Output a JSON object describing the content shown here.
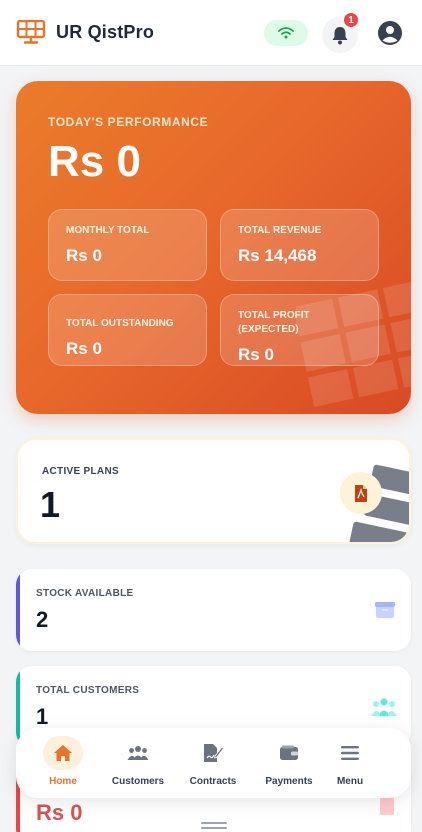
{
  "header": {
    "app_title": "UR QistPro",
    "logo_icon": "solar-panel-icon",
    "wifi_icon": "wifi-icon",
    "bell_icon": "bell-icon",
    "notification_count": "1",
    "profile_icon": "user-circle-icon"
  },
  "performance": {
    "label": "TODAY'S PERFORMANCE",
    "value": "Rs 0",
    "tiles": [
      {
        "label": "MONTHLY TOTAL",
        "value": "Rs 0"
      },
      {
        "label": "TOTAL REVENUE",
        "value": "Rs 14,468"
      },
      {
        "label": "TOTAL OUTSTANDING",
        "value": "Rs 0"
      },
      {
        "label": "TOTAL PROFIT (EXPECTED)",
        "value": "Rs 0"
      }
    ]
  },
  "active_plans": {
    "label": "ACTIVE PLANS",
    "value": "1",
    "icon": "pdf-document-icon"
  },
  "stats": [
    {
      "label": "STOCK AVAILABLE",
      "value": "2",
      "icon": "box-icon",
      "accent": "#5b5bd6"
    },
    {
      "label": "TOTAL CUSTOMERS",
      "value": "1",
      "icon": "users-icon",
      "accent": "#14b8a6"
    },
    {
      "value": "Rs 0",
      "accent": "#ef4444"
    }
  ],
  "nav": {
    "items": [
      {
        "label": "Home",
        "icon": "home-icon",
        "active": true
      },
      {
        "label": "Customers",
        "icon": "users-icon"
      },
      {
        "label": "Contracts",
        "icon": "contract-icon"
      },
      {
        "label": "Payments",
        "icon": "wallet-icon"
      },
      {
        "label": "Menu",
        "icon": "menu-icon"
      }
    ]
  },
  "colors": {
    "brand_orange": "#e8742c",
    "badge_red": "#ef4444",
    "stock_accent": "#5b5bd6",
    "customers_accent": "#14b8a6"
  }
}
